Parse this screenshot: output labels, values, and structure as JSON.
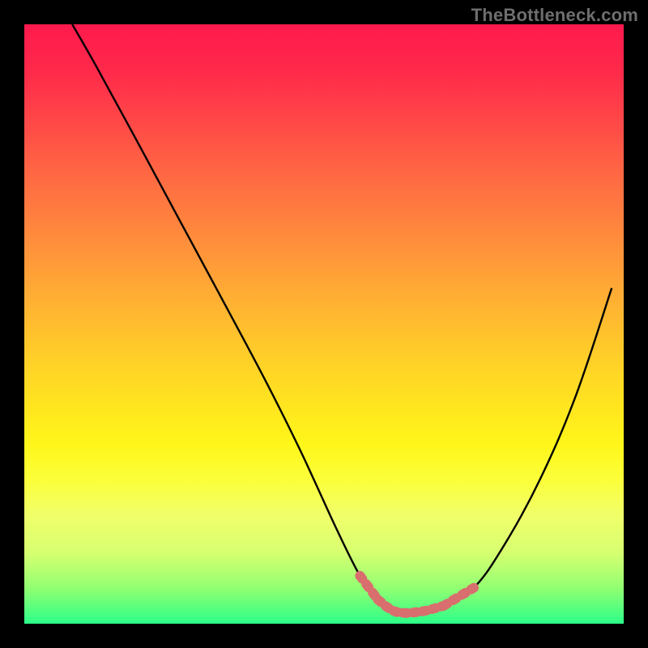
{
  "watermark": "TheBottleneck.com",
  "chart_data": {
    "type": "line",
    "title": "",
    "xlabel": "",
    "ylabel": "",
    "xlim": [
      0,
      100
    ],
    "ylim": [
      0,
      100
    ],
    "series": [
      {
        "name": "curve",
        "x": [
          8,
          12,
          18,
          25,
          32,
          40,
          46,
          52,
          56,
          59,
          62,
          66,
          70,
          75,
          80,
          86,
          92,
          98
        ],
        "y": [
          100,
          93,
          82,
          69,
          56,
          41,
          29,
          16,
          8,
          4,
          2,
          2,
          3,
          6,
          13,
          24,
          38,
          56
        ]
      }
    ],
    "marker_region": {
      "x_range": [
        55,
        75
      ],
      "color": "#d96e6e"
    },
    "background_gradient": {
      "top": "#ff1a4d",
      "bottom": "#2bff88"
    }
  }
}
